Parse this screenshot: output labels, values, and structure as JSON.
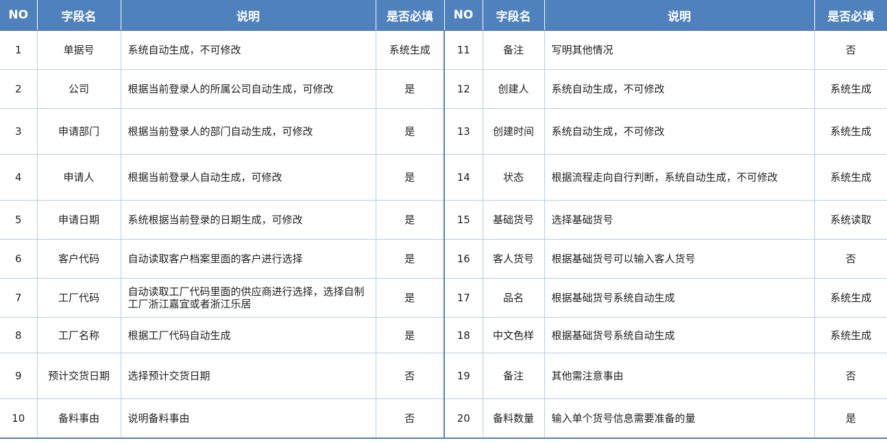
{
  "header": {
    "no": "NO",
    "field": "字段名",
    "desc": "说明",
    "required": "是否必填"
  },
  "rows": [
    {
      "left": {
        "no": "1",
        "field": "单据号",
        "desc": "系统自动生成，不可修改",
        "required": "系统生成"
      },
      "right": {
        "no": "11",
        "field": "备注",
        "desc": "写明其他情况",
        "required": "否"
      }
    },
    {
      "left": {
        "no": "2",
        "field": "公司",
        "desc": "根据当前登录人的所属公司自动生成，可修改",
        "required": "是"
      },
      "right": {
        "no": "12",
        "field": "创建人",
        "desc": "系统自动生成，不可修改",
        "required": "系统生成"
      }
    },
    {
      "left": {
        "no": "3",
        "field": "申请部门",
        "desc": "根据当前登录人的部门自动生成，可修改",
        "required": "是"
      },
      "right": {
        "no": "13",
        "field": "创建时间",
        "desc": "系统自动生成，不可修改",
        "required": "系统生成"
      }
    },
    {
      "left": {
        "no": "4",
        "field": "申请人",
        "desc": "根据当前登录人自动生成，可修改",
        "required": "是"
      },
      "right": {
        "no": "14",
        "field": "状态",
        "desc": "根据流程走向自行判断，系统自动生成，不可修改",
        "required": "系统生成"
      }
    },
    {
      "left": {
        "no": "5",
        "field": "申请日期",
        "desc": "系统根据当前登录的日期生成，可修改",
        "required": "是"
      },
      "right": {
        "no": "15",
        "field": "基础货号",
        "desc": "选择基础货号",
        "required": "系统读取"
      }
    },
    {
      "left": {
        "no": "6",
        "field": "客户代码",
        "desc": "自动读取客户档案里面的客户进行选择",
        "required": "是"
      },
      "right": {
        "no": "16",
        "field": "客人货号",
        "desc": "根据基础货号可以输入客人货号",
        "required": "否"
      }
    },
    {
      "left": {
        "no": "7",
        "field": "工厂代码",
        "desc": "自动读取工厂代码里面的供应商进行选择，选择自制工厂浙江嘉宜或者浙江乐居",
        "required": "是"
      },
      "right": {
        "no": "17",
        "field": "品名",
        "desc": "根据基础货号系统自动生成",
        "required": "系统生成"
      }
    },
    {
      "left": {
        "no": "8",
        "field": "工厂名称",
        "desc": "根据工厂代码自动生成",
        "required": "是"
      },
      "right": {
        "no": "18",
        "field": "中文色样",
        "desc": "根据基础货号系统自动生成",
        "required": "系统生成"
      }
    },
    {
      "left": {
        "no": "9",
        "field": "预计交货日期",
        "desc": "选择预计交货日期",
        "required": "否"
      },
      "right": {
        "no": "19",
        "field": "备注",
        "desc": "其他需注意事由",
        "required": "否"
      }
    },
    {
      "left": {
        "no": "10",
        "field": "备料事由",
        "desc": "说明备料事由",
        "required": "否"
      },
      "right": {
        "no": "20",
        "field": "备料数量",
        "desc": "输入单个货号信息需要准备的量",
        "required": "是"
      }
    }
  ]
}
